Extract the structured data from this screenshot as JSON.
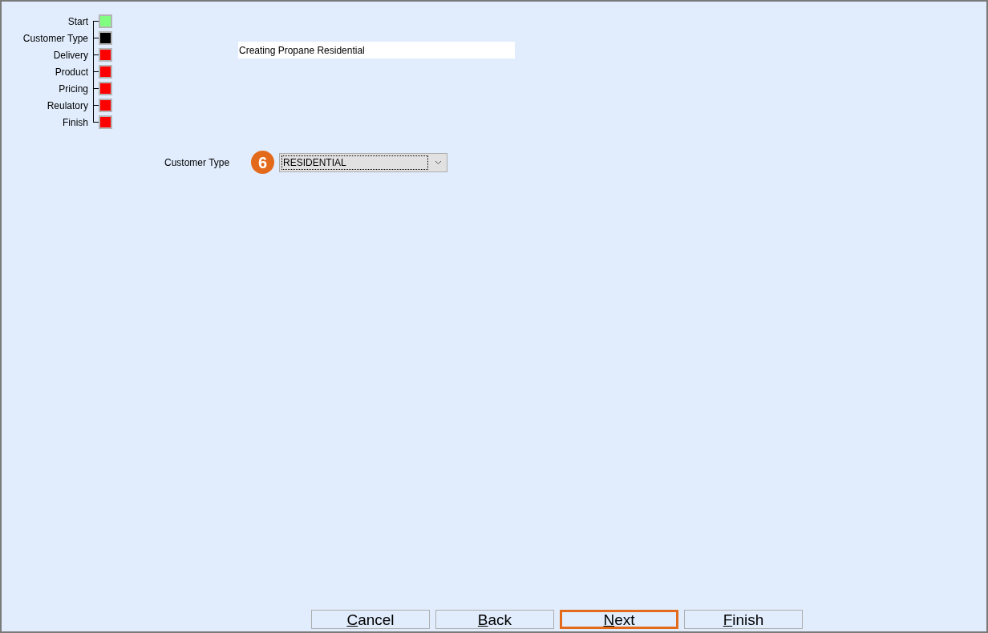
{
  "steps": [
    {
      "label": "Start",
      "color": "#80ff80"
    },
    {
      "label": "Customer Type",
      "color": "#000000"
    },
    {
      "label": "Delivery",
      "color": "#ff0000"
    },
    {
      "label": "Product",
      "color": "#ff0000"
    },
    {
      "label": "Pricing",
      "color": "#ff0000"
    },
    {
      "label": "Reulatory",
      "color": "#ff0000"
    },
    {
      "label": "Finish",
      "color": "#ff0000"
    }
  ],
  "title_field": {
    "value": "Creating Propane Residential"
  },
  "customer_type": {
    "label": "Customer Type",
    "callout": "6",
    "value": "RESIDENTIAL"
  },
  "buttons": [
    {
      "label": "Cancel",
      "highlighted": false
    },
    {
      "label": "Back",
      "highlighted": false
    },
    {
      "label": "Next",
      "highlighted": true
    },
    {
      "label": "Finish",
      "highlighted": false
    }
  ]
}
